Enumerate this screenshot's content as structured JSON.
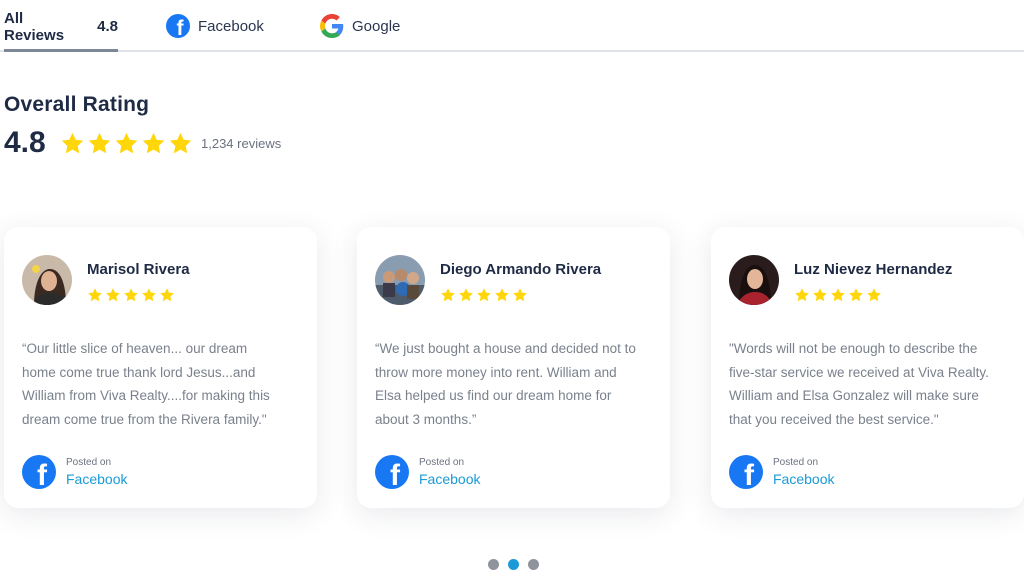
{
  "tabs": {
    "all": {
      "label": "All Reviews",
      "score": "4.8"
    },
    "facebook": {
      "label": "Facebook",
      "icon": "facebook-icon"
    },
    "google": {
      "label": "Google",
      "icon": "google-icon"
    }
  },
  "overall": {
    "title": "Overall Rating",
    "score": "4.8",
    "stars": 5,
    "count": "1,234 reviews"
  },
  "colors": {
    "star": "#ffd60a",
    "facebook": "#1877f2",
    "link": "#1a9bd7",
    "heading": "#1f2a44"
  },
  "reviews": [
    {
      "name": "Marisol Rivera",
      "rating": 5,
      "text": "“Our little slice of heaven... our dream home come true thank lord Jesus...and William from Viva Realty....for making this dream come true from the Rivera family.\"",
      "posted_on": "Posted on",
      "source": "Facebook"
    },
    {
      "name": "Diego Armando Rivera",
      "rating": 5,
      "text": "“We just bought a house and decided not to throw more money into rent. William and Elsa helped us find our dream home for about 3 months.”",
      "posted_on": "Posted on",
      "source": "Facebook"
    },
    {
      "name": "Luz Nievez Hernandez",
      "rating": 5,
      "text": "\"Words will not be enough to describe the five-star service we received at Viva Realty. William and Elsa Gonzalez will make sure that you received the best service.\"",
      "posted_on": "Posted on",
      "source": "Facebook"
    }
  ],
  "pagination": {
    "pages": 3,
    "active": 2
  }
}
